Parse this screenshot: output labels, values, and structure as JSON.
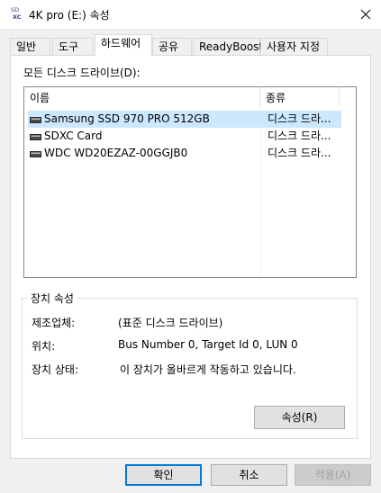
{
  "window": {
    "title": "4K pro (E:) 속성",
    "icon_name": "sd-card-icon",
    "icon_text_top": "SD",
    "icon_text_bottom": "XC"
  },
  "tabs": [
    {
      "label": "일반"
    },
    {
      "label": "도구"
    },
    {
      "label": "하드웨어",
      "active": true
    },
    {
      "label": "공유"
    },
    {
      "label": "ReadyBoost"
    },
    {
      "label": "사용자 지정"
    }
  ],
  "drives_section": {
    "label": "모든 디스크 드라이브(D):",
    "columns": [
      "이름",
      "종류"
    ],
    "rows": [
      {
        "name": "Samsung SSD 970 PRO 512GB",
        "type": "디스크 드라...",
        "selected": true
      },
      {
        "name": "SDXC Card",
        "type": "디스크 드라..."
      },
      {
        "name": "WDC WD20EZAZ-00GGJB0",
        "type": "디스크 드라..."
      }
    ]
  },
  "device_properties": {
    "title": "장치 속성",
    "manufacturer_label": "제조업체:",
    "manufacturer_value": "(표준 디스크 드라이브)",
    "location_label": "위치:",
    "location_value": "Bus Number 0, Target Id 0, LUN 0",
    "status_label": "장치 상태:",
    "status_value": "이 장치가 올바르게 작동하고 있습니다.",
    "properties_button": "속성(R)"
  },
  "footer": {
    "ok": "확인",
    "cancel": "취소",
    "apply": "적용(A)"
  },
  "colors": {
    "selection": "#cce8ff",
    "accent": "#0078d7"
  }
}
